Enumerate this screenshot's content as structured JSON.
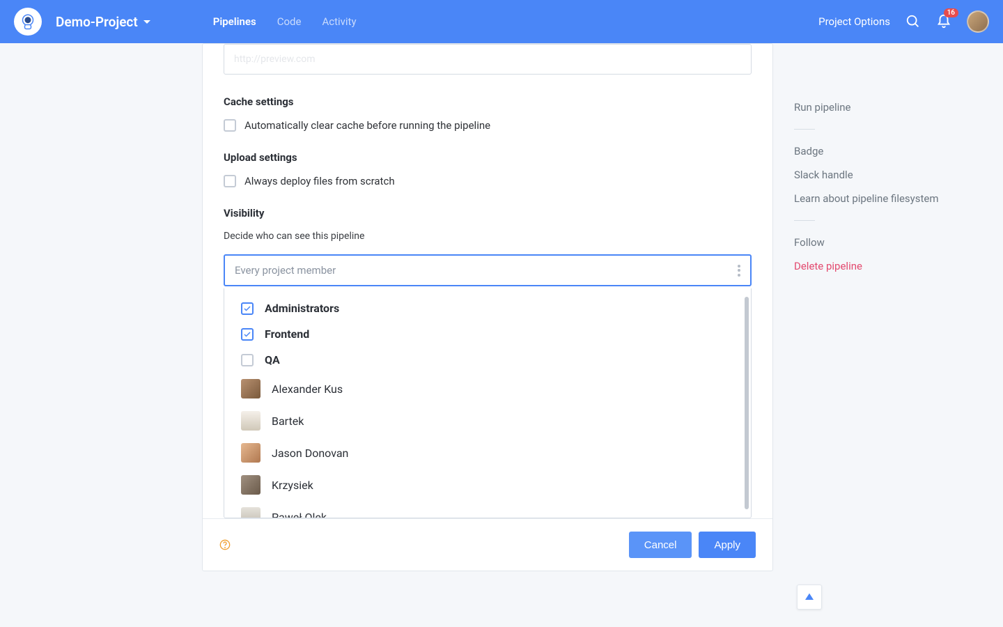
{
  "header": {
    "project_name": "Demo-Project",
    "tabs": {
      "pipelines": "Pipelines",
      "code": "Code",
      "activity": "Activity"
    },
    "project_options": "Project Options",
    "notifications": "16"
  },
  "form": {
    "url_placeholder": "http://preview.com",
    "cache_title": "Cache settings",
    "cache_option": "Automatically clear cache before running the pipeline",
    "upload_title": "Upload settings",
    "upload_option": "Always deploy files from scratch",
    "visibility_title": "Visibility",
    "visibility_desc": "Decide who can see this pipeline",
    "visibility_placeholder": "Every project member"
  },
  "popup": {
    "groups": [
      {
        "name": "Administrators",
        "checked": true
      },
      {
        "name": "Frontend",
        "checked": true
      },
      {
        "name": "QA",
        "checked": false
      }
    ],
    "users": [
      {
        "name": "Alexander Kus",
        "av": "av1"
      },
      {
        "name": "Bartek",
        "av": "av2"
      },
      {
        "name": "Jason Donovan",
        "av": "av3"
      },
      {
        "name": "Krzysiek",
        "av": "av4"
      },
      {
        "name": "Paweł Olek",
        "av": "av5"
      }
    ]
  },
  "footer": {
    "cancel": "Cancel",
    "apply": "Apply"
  },
  "sidebar": {
    "run": "Run pipeline",
    "badge": "Badge",
    "slack": "Slack handle",
    "learn": "Learn about pipeline filesystem",
    "follow": "Follow",
    "delete": "Delete pipeline"
  }
}
